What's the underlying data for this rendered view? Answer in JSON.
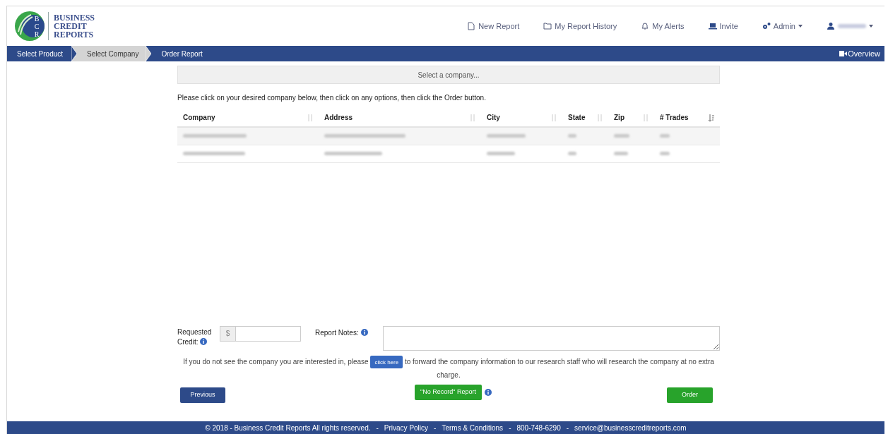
{
  "logo": {
    "monogram": [
      "B",
      "C",
      "R"
    ],
    "lines": [
      "BUSINESS",
      "CREDIT",
      "REPORTS"
    ]
  },
  "top_nav": [
    {
      "label": "New Report",
      "dropdown": false
    },
    {
      "label": "My Report History",
      "dropdown": false
    },
    {
      "label": "My Alerts",
      "dropdown": false
    },
    {
      "label": "Invite",
      "dropdown": false
    },
    {
      "label": "Admin",
      "dropdown": true
    },
    {
      "kind": "redacted",
      "dropdown": true
    }
  ],
  "steps": [
    {
      "label": "Select Product",
      "selected": false
    },
    {
      "label": "Select Company",
      "selected": true
    },
    {
      "label": "Order Report",
      "selected": false
    }
  ],
  "overview": "Overview",
  "company_select": {
    "placeholder": "Select a company..."
  },
  "instructions": "Please click on your desired company below, then click on any options, then click the Order button.",
  "table": {
    "columns": [
      "Company",
      "Address",
      "City",
      "State",
      "Zip",
      "# Trades"
    ],
    "rows": [
      {
        "kind": "redacted"
      },
      {
        "kind": "redacted"
      }
    ]
  },
  "requested_credit": {
    "label": "Requested Credit:",
    "prefix": "$"
  },
  "report_notes": {
    "label": "Report Notes:"
  },
  "notice": {
    "before": "If you do not see the company you are interested in, please",
    "button": "click here",
    "after": "to forward the company information to our research staff who will research the company at no extra charge."
  },
  "buttons": {
    "previous": "Previous",
    "no_record": "\"No Record\" Report",
    "order": "Order"
  },
  "footer": [
    "© 2018 - Business Credit Reports All rights reserved.",
    "-",
    "Privacy Policy",
    "-",
    "Terms & Conditions",
    "-",
    "800-748-6290",
    "-",
    "service@businesscreditreports.com"
  ]
}
